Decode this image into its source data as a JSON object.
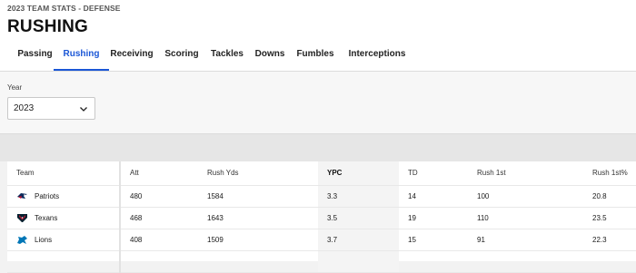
{
  "header": {
    "eyebrow": "2023 TEAM STATS - DEFENSE",
    "title": "RUSHING"
  },
  "tabs": [
    "Passing",
    "Rushing",
    "Receiving",
    "Scoring",
    "Tackles",
    "Downs",
    "Fumbles",
    "Interceptions"
  ],
  "active_tab": "Rushing",
  "filter": {
    "label": "Year",
    "selected": "2023"
  },
  "table": {
    "columns": [
      "Team",
      "Att",
      "Rush Yds",
      "YPC",
      "TD",
      "Rush 1st",
      "Rush 1st%"
    ],
    "sorted_column": "YPC",
    "rows": [
      {
        "team": "Patriots",
        "logo": "patriots-logo",
        "att": "480",
        "rush_yds": "1584",
        "ypc": "3.3",
        "td": "14",
        "rush_1st": "100",
        "rush_1st_pct": "20.8"
      },
      {
        "team": "Texans",
        "logo": "texans-logo",
        "att": "468",
        "rush_yds": "1643",
        "ypc": "3.5",
        "td": "19",
        "rush_1st": "110",
        "rush_1st_pct": "23.5"
      },
      {
        "team": "Lions",
        "logo": "lions-logo",
        "att": "408",
        "rush_yds": "1509",
        "ypc": "3.7",
        "td": "15",
        "rush_1st": "91",
        "rush_1st_pct": "22.3"
      }
    ]
  },
  "colors": {
    "accent": "#1a56d6",
    "patriots_navy": "#0b2a5b",
    "patriots_red": "#c8102e",
    "texans_navy": "#03202f",
    "texans_red": "#a71930",
    "lions_blue": "#0076b6"
  }
}
